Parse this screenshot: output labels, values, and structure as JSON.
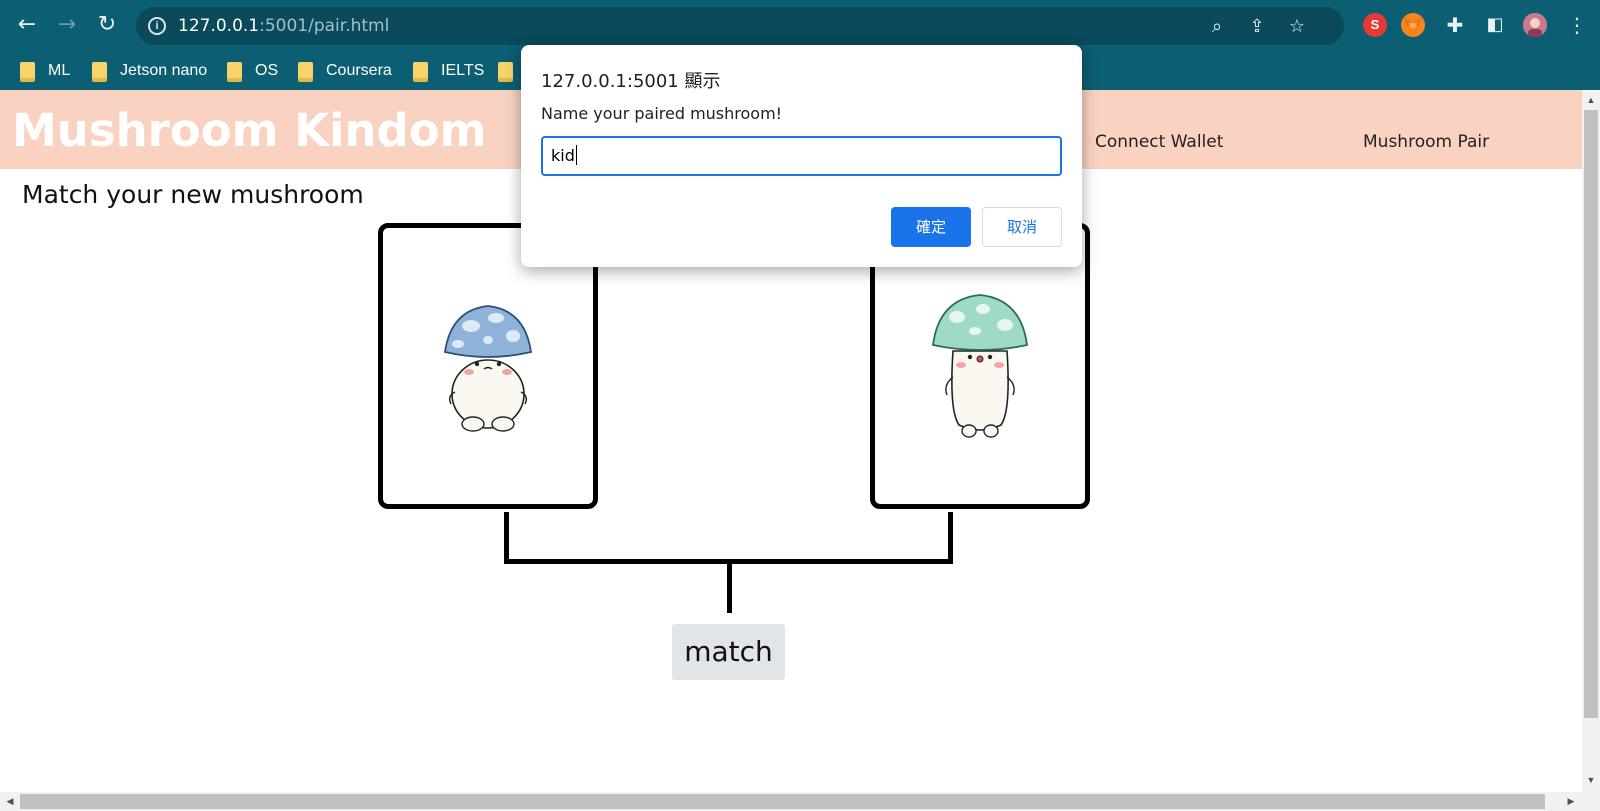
{
  "browser": {
    "url_host": "127.0.0.1",
    "url_rest": ":5001/pair.html",
    "bookmarks": [
      "ML",
      "Jetson nano",
      "OS",
      "Coursera",
      "IELTS"
    ],
    "extension_s_label": "S"
  },
  "page": {
    "site_title": "Mushroom Kindom",
    "nav": {
      "connect_wallet": "Connect Wallet",
      "mushroom_pair": "Mushroom Pair"
    },
    "heading": "Match your new mushroom",
    "match_button": "match"
  },
  "dialog": {
    "origin": "127.0.0.1:5001 顯示",
    "message": "Name your paired mushroom!",
    "input_value": "kid",
    "ok_label": "確定",
    "cancel_label": "取消"
  },
  "colors": {
    "chrome": "#0c5e73",
    "header": "#f9d2c1",
    "accent": "#1a73e8"
  }
}
